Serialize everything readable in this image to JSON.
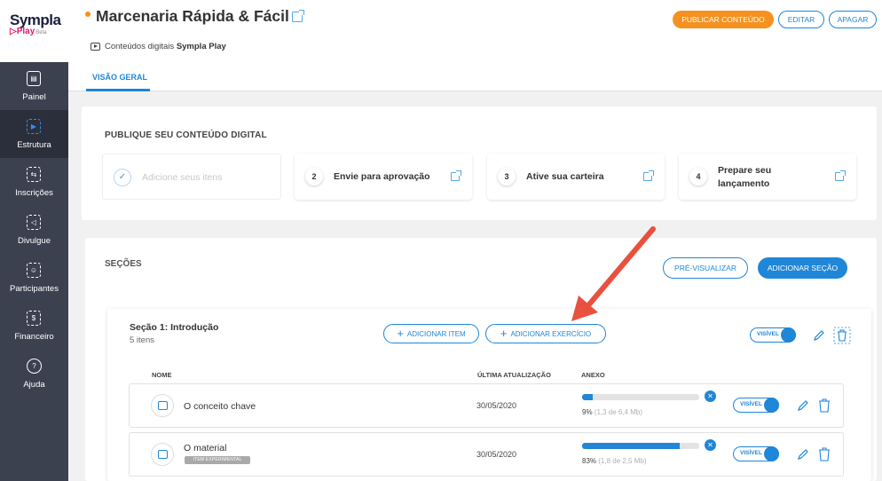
{
  "brand": {
    "name": "Sympla",
    "sub": "Play",
    "beta": "Beta"
  },
  "nav": [
    {
      "label": "Painel",
      "icon": "panel-icon",
      "glyph": "▤"
    },
    {
      "label": "Estrutura",
      "icon": "structure-icon",
      "glyph": "▶"
    },
    {
      "label": "Inscrições",
      "icon": "subscriptions-icon",
      "glyph": "⇆"
    },
    {
      "label": "Divulgue",
      "icon": "megaphone-icon",
      "glyph": "◁"
    },
    {
      "label": "Participantes",
      "icon": "participants-icon",
      "glyph": "☺"
    },
    {
      "label": "Financeiro",
      "icon": "finance-icon",
      "glyph": "$"
    },
    {
      "label": "Ajuda",
      "icon": "help-icon",
      "glyph": "?"
    }
  ],
  "header": {
    "title": "Marcenaria Rápida & Fácil",
    "subtitle_prefix": "Conteúdos digitais ",
    "subtitle_bold": "Sympla Play",
    "tab": "VISÃO GERAL",
    "publish": "PUBLICAR CONTEÚDO",
    "edit": "EDITAR",
    "delete": "APAGAR"
  },
  "publish": {
    "title": "PUBLIQUE SEU CONTEÚDO DIGITAL",
    "steps": [
      {
        "num": "✓",
        "label": "Adicione seus itens"
      },
      {
        "num": "2",
        "label": "Envie para aprovação"
      },
      {
        "num": "3",
        "label": "Ative sua carteira"
      },
      {
        "num": "4",
        "label": "Prepare seu lançamento"
      }
    ]
  },
  "sections": {
    "title": "SEÇÕES",
    "preview": "PRÉ-VISUALIZAR",
    "add_section": "ADICIONAR SEÇÃO",
    "section": {
      "name": "Seção 1: Introdução",
      "count": "5 itens",
      "add_item": "ADICIONAR ITEM",
      "add_exercise": "ADICIONAR EXERCÍCIO",
      "visible": "VISÍVEL"
    },
    "columns": {
      "name": "NOME",
      "updated": "ÚLTIMA ATUALIZAÇÃO",
      "attachment": "ANEXO"
    },
    "rows": [
      {
        "name": "O conceito chave",
        "badge": "",
        "date": "30/05/2020",
        "progress": 0.09,
        "pct": "9%",
        "size": "(1,3 de 6,4 Mb)",
        "visible": "VISÍVEL",
        "icon": "video-icon"
      },
      {
        "name": "O material",
        "badge": "ITEM EXPERIMENTAL",
        "date": "30/05/2020",
        "progress": 0.83,
        "pct": "83%",
        "size": "(1,8 de 2,5 Mb)",
        "visible": "VISÍVEL",
        "icon": "attachment-icon"
      }
    ]
  },
  "colors": {
    "accent": "#1f86d8",
    "publish": "#f5911e",
    "sidebar": "#3c4150",
    "arrow": "#e8513e"
  }
}
